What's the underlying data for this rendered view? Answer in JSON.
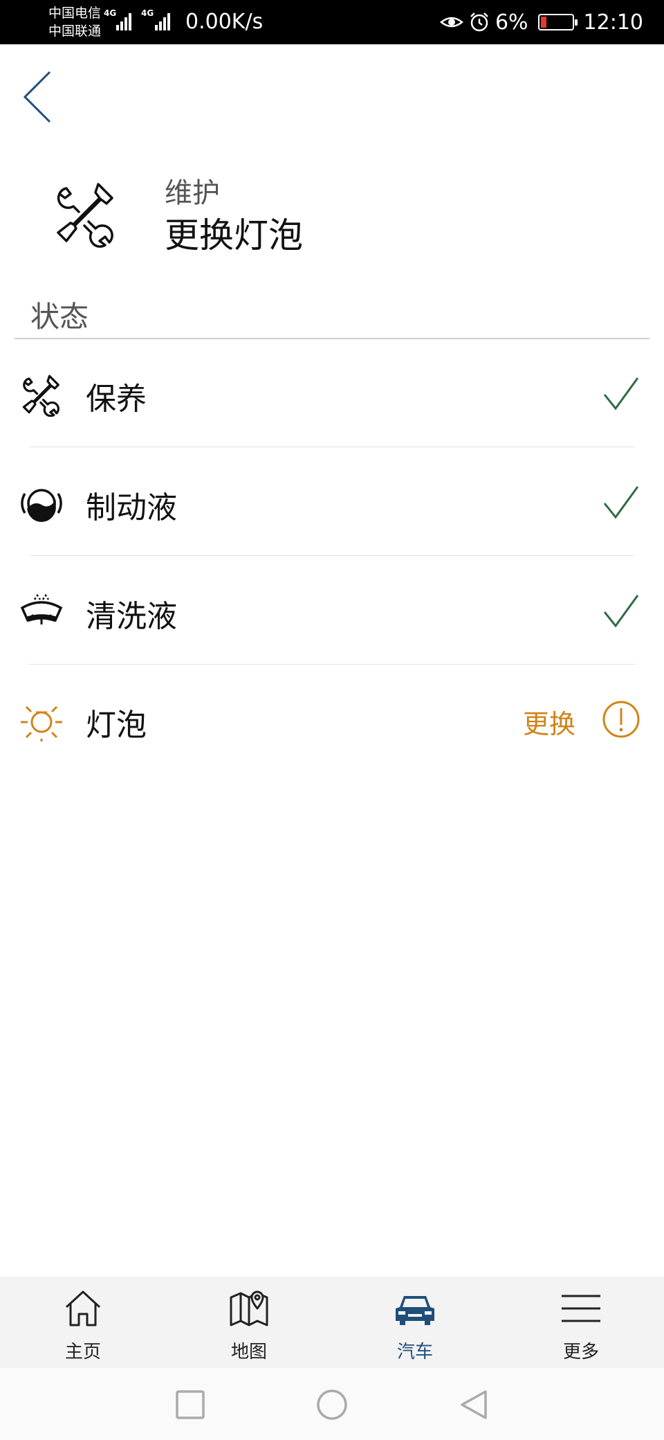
{
  "status_bar": {
    "carrier_1": "中国电信",
    "carrier_2": "中国联通",
    "network_1": "4G",
    "network_2": "4G",
    "speed": "0.00K/s",
    "battery": "6%",
    "battery_color": "#e53935",
    "time": "12:10",
    "icons": [
      "eye-icon",
      "alarm-icon",
      "battery-icon"
    ]
  },
  "header": {
    "back_icon": "chevron-left-icon",
    "category_icon": "wrench-screwdriver-icon",
    "category": "维护",
    "title": "更换灯泡"
  },
  "section": {
    "title": "状态"
  },
  "items": [
    {
      "label": "保养",
      "icon": "wrench-screwdriver-icon",
      "status": "ok"
    },
    {
      "label": "制动液",
      "icon": "brake-fluid-icon",
      "status": "ok"
    },
    {
      "label": "清洗液",
      "icon": "washer-fluid-icon",
      "status": "ok"
    },
    {
      "label": "灯泡",
      "icon": "bulb-icon",
      "status": "warning",
      "action": "更换"
    }
  ],
  "colors": {
    "accent_blue": "#1f4e79",
    "ok_green": "#2e6b43",
    "warning_orange": "#d08417"
  },
  "bottom_nav": [
    {
      "label": "主页",
      "icon": "home-icon",
      "active": false
    },
    {
      "label": "地图",
      "icon": "map-icon",
      "active": false
    },
    {
      "label": "汽车",
      "icon": "car-icon",
      "active": true
    },
    {
      "label": "更多",
      "icon": "menu-icon",
      "active": false
    }
  ],
  "system_nav": [
    "recents-square-icon",
    "home-circle-icon",
    "back-triangle-icon"
  ]
}
